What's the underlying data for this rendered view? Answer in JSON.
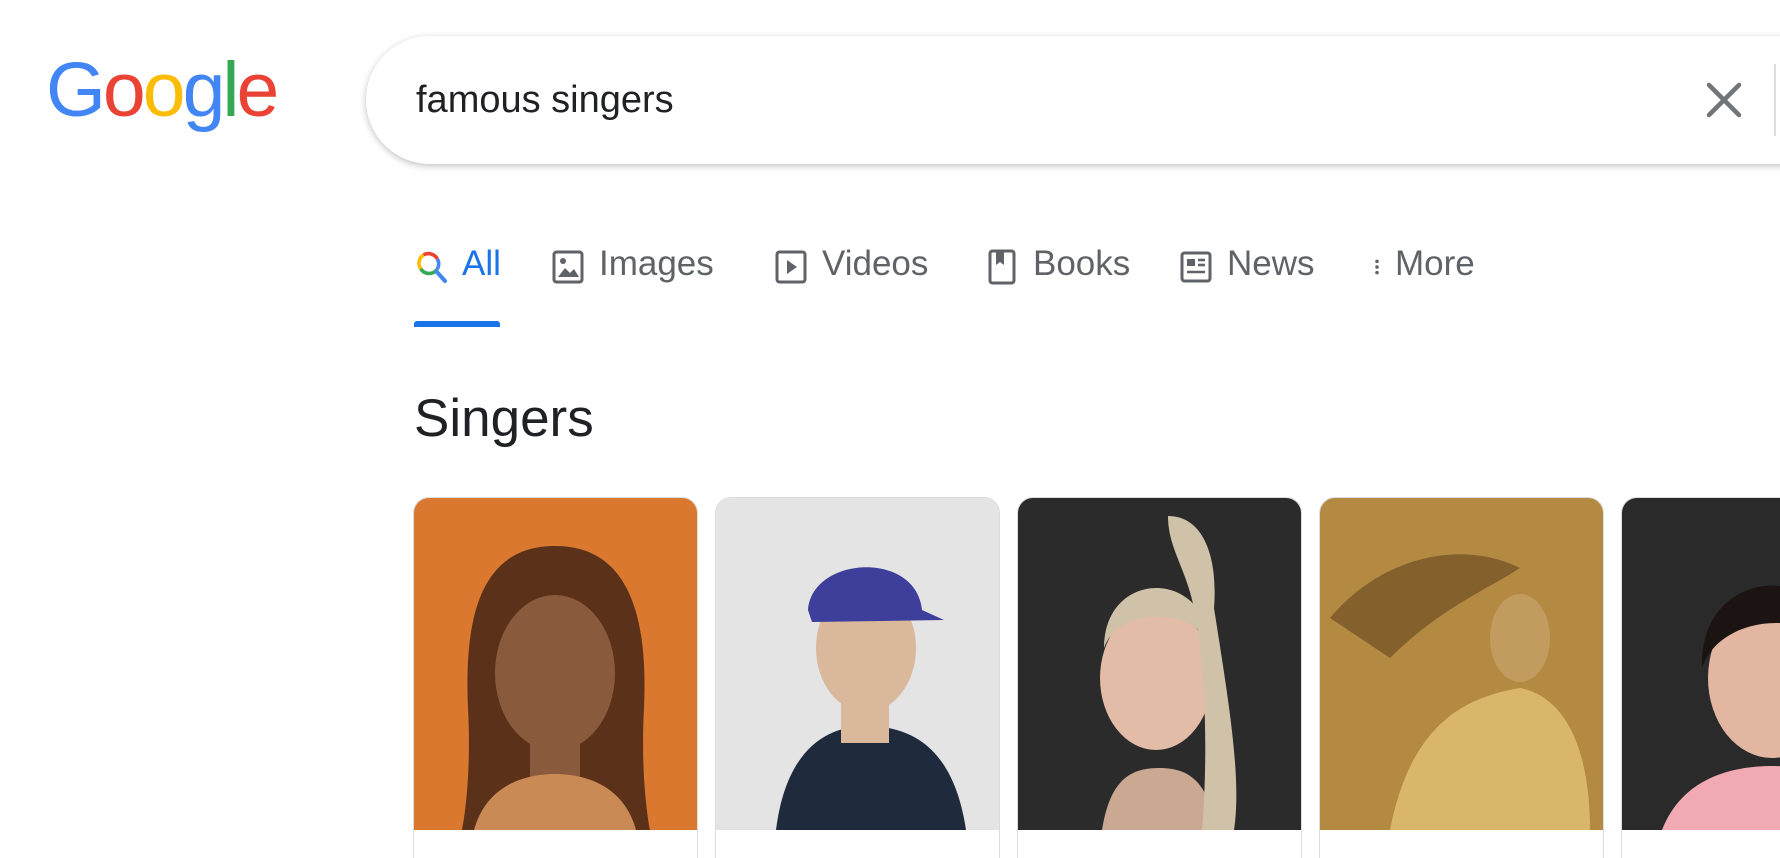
{
  "logo": {
    "text": "Google",
    "letters": [
      "G",
      "o",
      "o",
      "g",
      "l",
      "e"
    ]
  },
  "search": {
    "value": "famous singers"
  },
  "tabs": [
    {
      "label": "All",
      "icon": "search-icon",
      "active": true
    },
    {
      "label": "Images",
      "icon": "image-icon"
    },
    {
      "label": "Videos",
      "icon": "play-icon"
    },
    {
      "label": "Books",
      "icon": "book-icon"
    },
    {
      "label": "News",
      "icon": "news-icon"
    },
    {
      "label": "More",
      "icon": "more-vert-icon"
    }
  ],
  "section": {
    "title": "Singers"
  },
  "cards": [
    {
      "bg": "#d9782e",
      "skin": "#8a5a3c",
      "hair": "#5b3219",
      "top": "#c98a55"
    },
    {
      "bg": "#e4e4e4",
      "skin": "#d9b89c",
      "hair": "#3d3f9b",
      "top": "#1f2a3d"
    },
    {
      "bg": "#2b2b2b",
      "skin": "#e2bca7",
      "hair": "#cfc2a8",
      "top": "#caa891"
    },
    {
      "bg": "#b48a43",
      "skin": "#c29b5e",
      "hair": "#6e4f22",
      "top": "#d9b66a"
    },
    {
      "bg": "#2a2a2a",
      "skin": "#e2b6a1",
      "hair": "#1b1412",
      "top": "#f1a9b3"
    }
  ],
  "colors": {
    "blue": "#4285F4",
    "red": "#EA4335",
    "yellow": "#FBBC05",
    "green": "#34A853",
    "active_tab": "#1a73e8",
    "tab_text": "#5f6368"
  }
}
